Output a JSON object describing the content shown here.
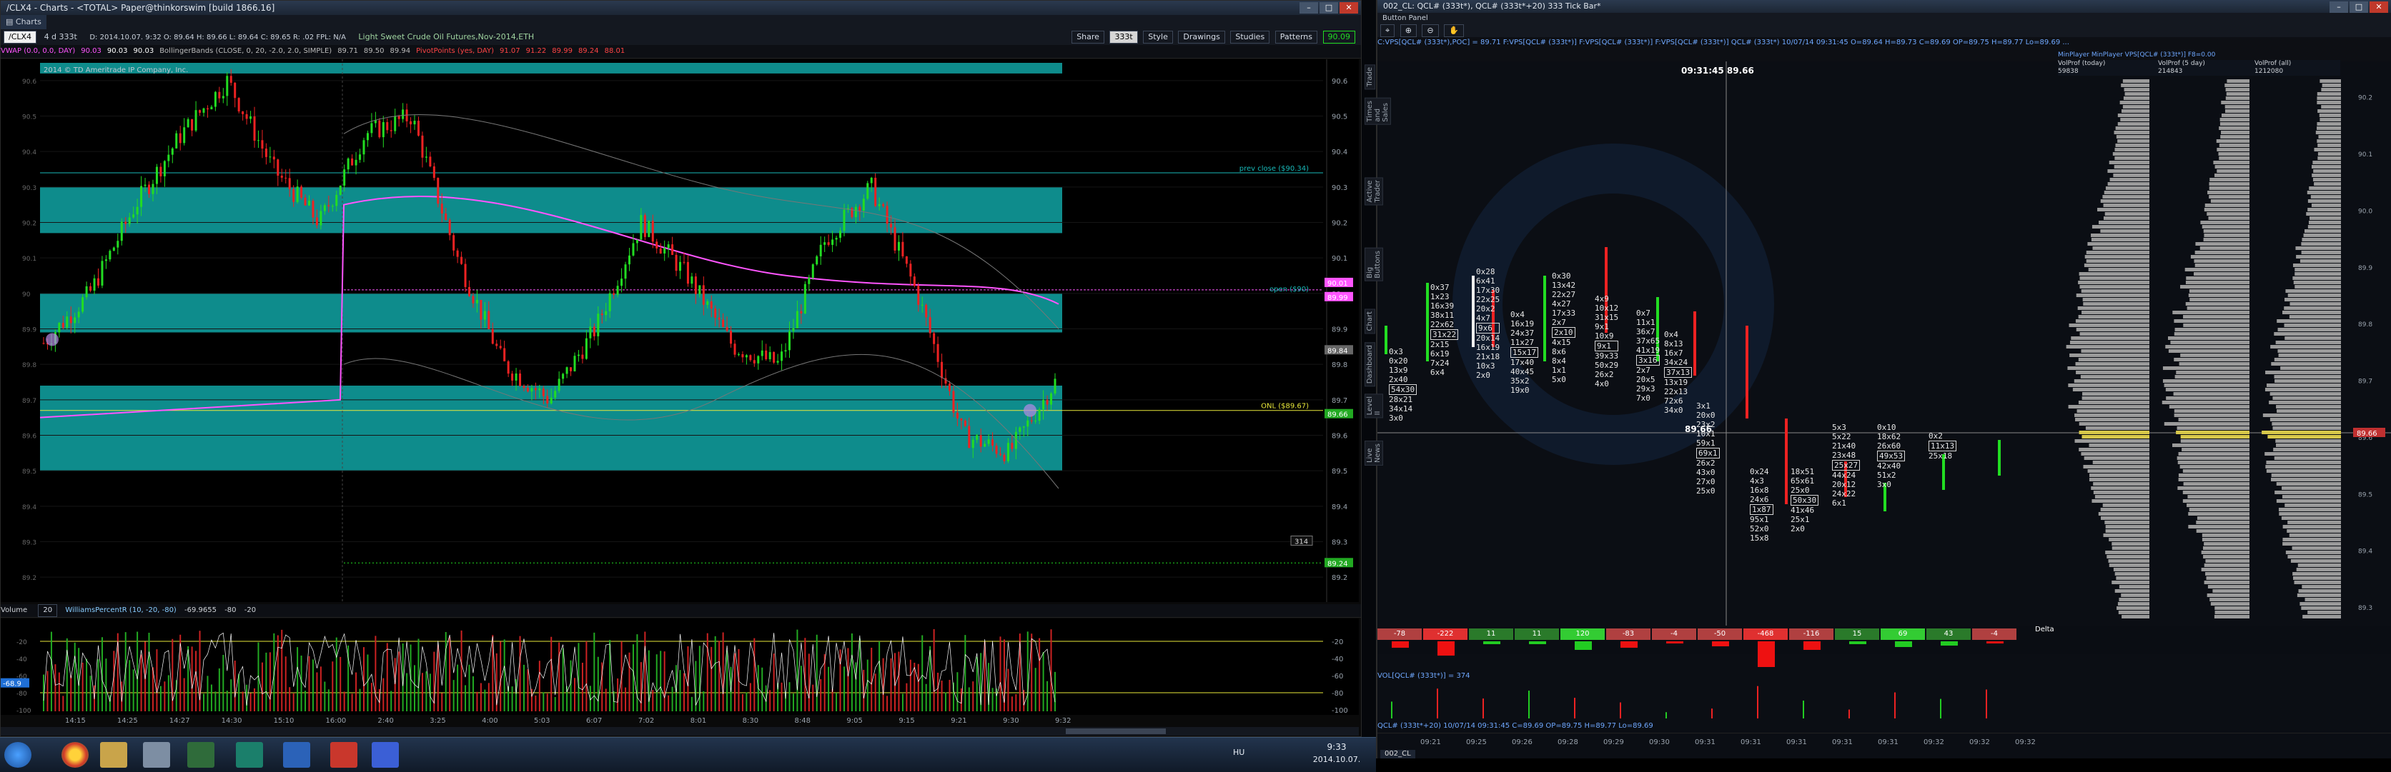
{
  "left_window": {
    "title": "/CLX4 - Charts - <TOTAL> Paper@thinkorswim [build 1866.16]",
    "charts_tab": "Charts",
    "symbol_box": "/CLX4",
    "aggregation": "4 d 333t",
    "quote_header": "D: 2014.10.07. 9:32  O: 89.64  H: 89.66  L: 89.64  C: 89.65  R: .02  FPL: N/A",
    "description": "Light Sweet Crude Oil Futures,Nov-2014,ETH",
    "buttons": {
      "share": "Share",
      "aggr": "333t",
      "style": "Style",
      "drawings": "Drawings",
      "studies": "Studies",
      "patterns": "Patterns"
    },
    "last_price": "90.09",
    "studies_line": [
      {
        "text": "VWAP (0.0, 0.0, DAY)",
        "color": "#ff55ff"
      },
      {
        "text": "90.03",
        "color": "#ff55ff"
      },
      {
        "text": "90.03",
        "color": "#ffffff"
      },
      {
        "text": "90.03",
        "color": "#ffffff"
      },
      {
        "text": "BollingerBands (CLOSE, 0, 20, -2.0, 2.0, SIMPLE)",
        "color": "#bbbbbb"
      },
      {
        "text": "89.71",
        "color": "#bbbbbb"
      },
      {
        "text": "89.50",
        "color": "#bbbbbb"
      },
      {
        "text": "89.94",
        "color": "#bbbbbb"
      },
      {
        "text": "PivotPoints (yes, DAY)",
        "color": "#ff4444"
      },
      {
        "text": "91.07",
        "color": "#ff4444"
      },
      {
        "text": "91.22",
        "color": "#ff4444"
      },
      {
        "text": "89.99",
        "color": "#ff4444"
      },
      {
        "text": "89.24",
        "color": "#ff4444"
      },
      {
        "text": "88.01",
        "color": "#ff4444"
      }
    ],
    "copyright": "2014 © TD Ameritrade IP Company, Inc.",
    "price_axis": [
      "90.6",
      "90.5",
      "90.4",
      "90.3",
      "90.2",
      "90.1",
      "90",
      "89.9",
      "89.8",
      "89.7",
      "89.6",
      "89.5",
      "89.4",
      "89.3",
      "89.2"
    ],
    "annotations": {
      "prev_close": "prev close ($90.34)",
      "open": "open ($90)",
      "onl": "ONL ($89.67)",
      "tag_open": "90.01",
      "tag_vwap": "89.99",
      "tag_mid": "89.84",
      "tag_last": "89.66",
      "tag_volume_count": "314",
      "tag_bottom": "89.24"
    },
    "lower_study": {
      "volume": "Volume",
      "volume_value": "20",
      "willr": "WilliamsPercentR (10, -20, -80)",
      "willr_value": "-69.9655",
      "level1": "-80",
      "level2": "-20",
      "axis": [
        "-20",
        "-40",
        "-60",
        "-80",
        "-100"
      ],
      "current_tag": "-68.9"
    },
    "time_axis": [
      "14:15",
      "14:25",
      "14:27",
      "14:30",
      "15:10",
      "16:00",
      "2:40",
      "3:25",
      "4:00",
      "5:03",
      "6:07",
      "7:02",
      "8:01",
      "8:30",
      "8:48",
      "9:05",
      "9:15",
      "9:21",
      "9:30",
      "9:32"
    ]
  },
  "right_window": {
    "title": "002_CL: QCL# (333t*), QCL# (333t*+20) 333 Tick Bar*",
    "button_panel": "Button Panel",
    "indicator_line": "C:VPS[QCL# (333t*),POC] = 89.71  F:VPS[QCL# (333t*)] F:VPS[QCL# (333t*)] F:VPS[QCL# (333t*)]   QCL# (333t*) 10/07/14 09:31:45  O=89.64  H=89.73  C=89.69  OP=89.75  H=89.77  Lo=89.69  ...",
    "vp_tabs": [
      "VolProf (today)",
      "VolProf (5 day)",
      "VolProf (all)"
    ],
    "vp_values": [
      "59838",
      "214843",
      "1212080"
    ],
    "vp_header": "MinPlayer  MinPlayer  VPS[QCL# (333t*)] F8=0.00",
    "cursor_time": "09:31:45  89.66",
    "cursor_price": "89.66",
    "price_axis": [
      "90.2",
      "90.1",
      "90.0",
      "89.9",
      "89.8",
      "89.7",
      "89.6",
      "89.5",
      "89.4",
      "89.3"
    ],
    "price_tag": "89.66",
    "delta_label": "Delta",
    "delta_values": [
      "-78",
      "-222",
      "11",
      "11",
      "120",
      "-83",
      "-4",
      "-50",
      "-468",
      "-116",
      "15",
      "69",
      "43",
      "-4"
    ],
    "vol_label": "VOL[QCL# (333t*)] = 374",
    "bottom_label": "QCL# (333t*+20) 10/07/14 09:31:45  C=89.69  OP=89.75  H=89.77  Lo=89.69",
    "time_axis": [
      "09:21",
      "09:25",
      "09:26",
      "09:28",
      "09:29",
      "09:30",
      "09:31",
      "09:31",
      "09:31",
      "09:31",
      "09:31",
      "09:32",
      "09:32",
      "09:32"
    ],
    "tab_bottom": "002_CL",
    "side_tabs": [
      "Trade",
      "Times and Sales",
      "Active Trader",
      "Big Buttons",
      "Chart",
      "Dashboard",
      "Level II",
      "Live News"
    ],
    "footprint_columns": [
      [
        "0x3",
        "0x20",
        "13x9",
        "2x40",
        "54x30",
        "28x21",
        "34x14",
        "3x0"
      ],
      [
        "0x37",
        "1x23",
        "16x39",
        "38x11",
        "22x62",
        "31x22",
        "2x15",
        "6x19",
        "7x24",
        "6x4"
      ],
      [
        "0x28",
        "6x41",
        "17x30",
        "22x25",
        "20x2",
        "4x7",
        "9x6",
        "20x14",
        "16x19",
        "21x18",
        "10x3",
        "2x0"
      ],
      [
        "0x4",
        "16x19",
        "24x37",
        "11x27",
        "15x17",
        "17x40",
        "40x45",
        "35x2",
        "19x0"
      ],
      [
        "0x30",
        "13x42",
        "22x27",
        "4x27",
        "17x33",
        "2x7",
        "2x10",
        "4x15",
        "8x6",
        "8x4",
        "1x1",
        "5x0"
      ],
      [
        "4x9",
        "10x12",
        "31x15",
        "9x1",
        "10x9",
        "9x1",
        "39x33",
        "50x29",
        "26x2",
        "4x0"
      ],
      [
        "0x7",
        "11x1",
        "36x7",
        "37x65",
        "41x19",
        "3x16",
        "2x7",
        "20x5",
        "29x3",
        "7x0"
      ],
      [
        "0x4",
        "8x13",
        "16x7",
        "34x24",
        "37x13",
        "13x19",
        "22x13",
        "72x6",
        "34x0"
      ],
      [
        "3x1",
        "20x0",
        "23x2",
        "10x1",
        "59x1",
        "69x1",
        "26x2",
        "43x0",
        "27x0",
        "25x0"
      ],
      [
        "0x24",
        "4x3",
        "16x8",
        "24x6",
        "1x87",
        "95x1",
        "52x0",
        "15x8"
      ],
      [
        "18x51",
        "65x61",
        "25x0",
        "50x30",
        "41x46",
        "25x1",
        "2x0"
      ],
      [
        "5x3",
        "5x22",
        "21x40",
        "23x48",
        "25x27",
        "44x24",
        "20x12",
        "24x22",
        "6x1"
      ],
      [
        "0x10",
        "18x62",
        "26x60",
        "49x53",
        "42x40",
        "51x2",
        "3x0"
      ],
      [
        "0x2",
        "11x13",
        "25x18"
      ]
    ]
  },
  "taskbar": {
    "lang": "HU",
    "time": "9:33",
    "date": "2014.10.07."
  },
  "colors": {
    "bull": "#22dd22",
    "bear": "#ee2222",
    "band": "#0e8c8c",
    "vwap": "#ff55ff",
    "accent": "#1f6fd6"
  }
}
